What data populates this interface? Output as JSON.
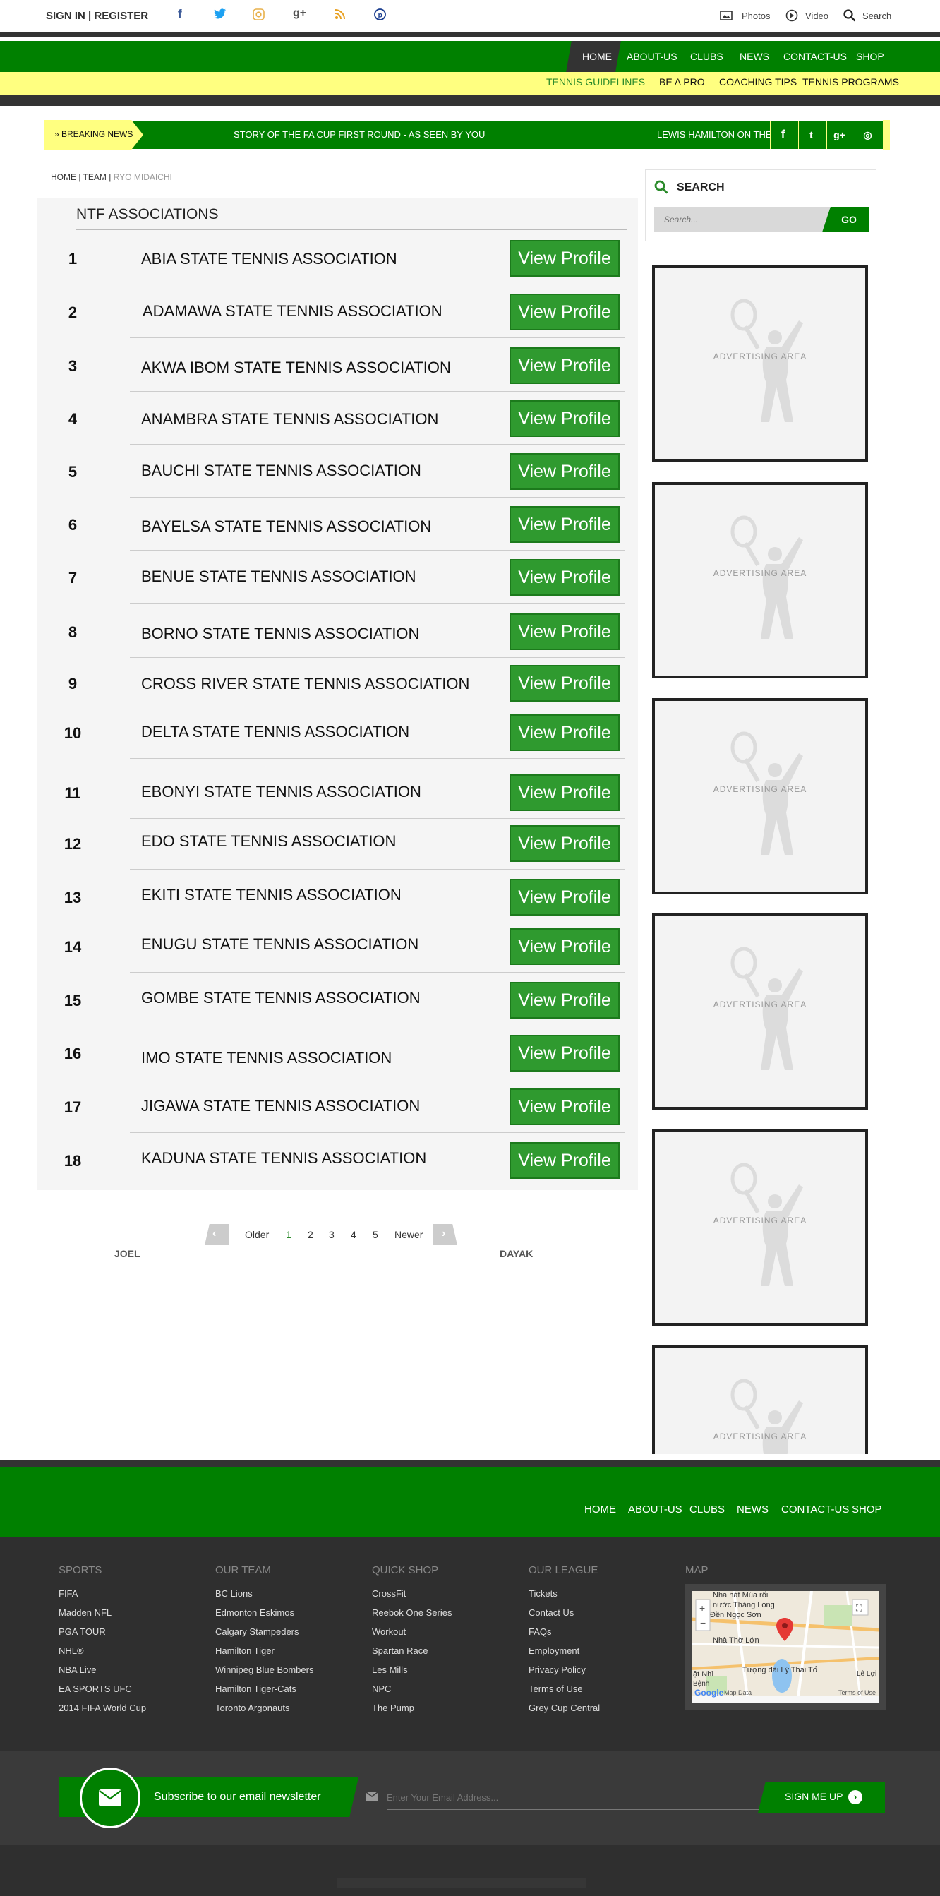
{
  "topbar": {
    "sign_in": "SIGN IN",
    "sep": "|",
    "register": "REGISTER",
    "photos": "Photos",
    "video": "Video",
    "search": "Search",
    "social": [
      {
        "icon": "facebook-icon",
        "glyph": "f",
        "color": "#3b5998"
      },
      {
        "icon": "twitter-icon",
        "glyph": "t",
        "color": "#1da1f2"
      },
      {
        "icon": "instagram-icon",
        "glyph": "◎",
        "color": "#e0a000"
      },
      {
        "icon": "google-plus-icon",
        "glyph": "g+",
        "color": "#555"
      },
      {
        "icon": "rss-icon",
        "glyph": "⌇",
        "color": "#e0a000"
      },
      {
        "icon": "pinterest-icon",
        "glyph": "℗",
        "color": "#1a3d8f"
      }
    ]
  },
  "nav": {
    "items": [
      "HOME",
      "ABOUT-US",
      "CLUBS",
      "NEWS",
      "CONTACT-US",
      "SHOP"
    ]
  },
  "subnav": {
    "items": [
      "TENNIS GUIDELINES",
      "BE A PRO",
      "COACHING TIPS",
      "TENNIS PROGRAMS"
    ]
  },
  "breaking": {
    "label": "BREAKING NEWS",
    "story1": "STORY OF THE FA CUP FIRST ROUND - AS SEEN BY YOU",
    "story2": "LEWIS HAMILTON ON THE LEG"
  },
  "breadcrumb": {
    "home": "HOME",
    "sep": "|",
    "team": "TEAM",
    "current": "RYO MIDAICHI"
  },
  "section": {
    "title": "NTF ASSOCIATIONS"
  },
  "associations": [
    {
      "num": "1",
      "name": "ABIA STATE TENNIS ASSOCIATION",
      "button": "View Profile"
    },
    {
      "num": "2",
      "name": "ADAMAWA STATE TENNIS ASSOCIATION",
      "button": "View Profile"
    },
    {
      "num": "3",
      "name": "AKWA IBOM STATE TENNIS ASSOCIATION",
      "button": "View Profile"
    },
    {
      "num": "4",
      "name": "ANAMBRA STATE TENNIS ASSOCIATION",
      "button": "View Profile"
    },
    {
      "num": "5",
      "name": "BAUCHI STATE TENNIS ASSOCIATION",
      "button": "View Profile"
    },
    {
      "num": "6",
      "name": "BAYELSA STATE TENNIS ASSOCIATION",
      "button": "View Profile"
    },
    {
      "num": "7",
      "name": "BENUE STATE TENNIS ASSOCIATION",
      "button": "View Profile"
    },
    {
      "num": "8",
      "name": "BORNO STATE TENNIS ASSOCIATION",
      "button": "View Profile"
    },
    {
      "num": "9",
      "name": "CROSS RIVER STATE TENNIS ASSOCIATION",
      "button": "View Profile"
    },
    {
      "num": "10",
      "name": "DELTA STATE TENNIS ASSOCIATION",
      "button": "View Profile"
    },
    {
      "num": "11",
      "name": "EBONYI STATE TENNIS ASSOCIATION",
      "button": "View Profile"
    },
    {
      "num": "12",
      "name": "EDO STATE TENNIS ASSOCIATION",
      "button": "View Profile"
    },
    {
      "num": "13",
      "name": "EKITI STATE TENNIS ASSOCIATION",
      "button": "View Profile"
    },
    {
      "num": "14",
      "name": "ENUGU STATE TENNIS ASSOCIATION",
      "button": "View Profile"
    },
    {
      "num": "15",
      "name": "GOMBE STATE TENNIS ASSOCIATION",
      "button": "View Profile"
    },
    {
      "num": "16",
      "name": "IMO STATE TENNIS ASSOCIATION",
      "button": "View Profile"
    },
    {
      "num": "17",
      "name": "JIGAWA STATE TENNIS ASSOCIATION",
      "button": "View Profile"
    },
    {
      "num": "18",
      "name": "KADUNA STATE TENNIS ASSOCIATION",
      "button": "View Profile"
    }
  ],
  "pagination": {
    "older": "Older",
    "pages": [
      "1",
      "2",
      "3",
      "4",
      "5"
    ],
    "newer": "Newer",
    "left_name": "JOEL",
    "right_name": "DAYAK"
  },
  "sidebar": {
    "search_title": "SEARCH",
    "search_placeholder": "Search...",
    "go": "GO",
    "ad_text": "ADVERTISING AREA"
  },
  "footer_nav": {
    "items": [
      "HOME",
      "ABOUT-US",
      "CLUBS",
      "NEWS",
      "CONTACT-US",
      "SHOP"
    ]
  },
  "footer": {
    "columns": [
      {
        "title": "SPORTS",
        "links": [
          "FIFA",
          "Madden NFL",
          "PGA TOUR",
          "NHL®",
          "NBA Live",
          "EA SPORTS UFC",
          "2014 FIFA World Cup"
        ]
      },
      {
        "title": "OUR TEAM",
        "links": [
          "BC Lions",
          "Edmonton Eskimos",
          "Calgary Stampeders",
          "Hamilton Tiger",
          "Winnipeg Blue Bombers",
          "Hamilton Tiger-Cats",
          "Toronto Argonauts"
        ]
      },
      {
        "title": "QUICK SHOP",
        "links": [
          "CrossFit",
          "Reebok One Series",
          "Workout",
          "Spartan Race",
          "Les Mills",
          "NPC",
          "The Pump"
        ]
      },
      {
        "title": "OUR LEAGUE",
        "links": [
          "Tickets",
          "Contact Us",
          "FAQs",
          "Employment",
          "Privacy Policy",
          "Terms of Use",
          "Grey Cup Central"
        ]
      }
    ],
    "map_title": "MAP",
    "map_labels": [
      "Nhà hát Múa rối",
      "nước Thăng Long",
      "Đền Ngọc Sơn",
      "Nhà Thờ Lớn",
      "Tượng đài Lý Thái Tổ",
      "ật Nhì",
      "Bệnh",
      "Lê Lợi",
      "Map Data",
      "Terms of Use",
      "Google"
    ]
  },
  "newsletter": {
    "text": "Subscribe to our email newsletter",
    "placeholder": "Enter Your Email Address...",
    "button": "SIGN ME UP"
  },
  "colors": {
    "green": "#008000",
    "yellow": "#ffff80",
    "button_green": "#2f9a2f",
    "dark": "#333333"
  }
}
